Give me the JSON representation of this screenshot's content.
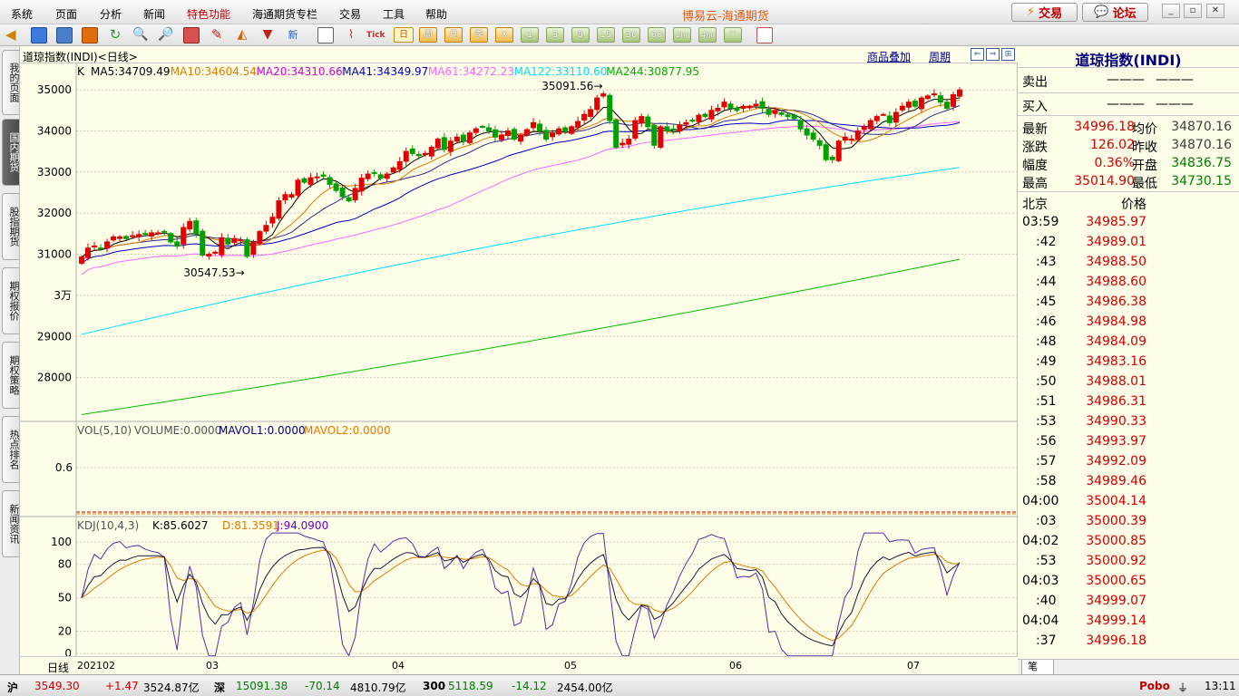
{
  "menu": {
    "items": [
      "系统",
      "页面",
      "分析",
      "新闻",
      "特色功能",
      "海通期货专栏",
      "交易",
      "工具",
      "帮助"
    ],
    "highlight_index": 4,
    "brand": "博易云-海通期货",
    "trade_btn": "交易",
    "forum_btn": "论坛"
  },
  "toolbar": {
    "periods": [
      "日",
      "周",
      "月",
      "季",
      "X",
      "1",
      "3",
      "5",
      "15",
      "30",
      "60",
      "2hr",
      "4hr",
      "Y"
    ],
    "selected_period": "日"
  },
  "left_tabs": [
    "我的页面",
    "国内期货",
    "股指期货",
    "期权报价",
    "期权策略",
    "热点排名",
    "新闻资讯"
  ],
  "left_tabs_active": 1,
  "chart": {
    "header_title": "道琼指数(INDI)<日线>",
    "link_overlay": "商品叠加",
    "link_period": "周期",
    "k_label": "K",
    "ma_labels": [
      {
        "text": "MA5:34709.49",
        "color": "#000000"
      },
      {
        "text": "MA10:34604.54",
        "color": "#e07b00"
      },
      {
        "text": "MA20:34310.66",
        "color": "#d400d4"
      },
      {
        "text": "MA41:34349.97",
        "color": "#0000c0"
      },
      {
        "text": "MA61:34272.23",
        "color": "#ff66ff"
      },
      {
        "text": "MA122:33110.60",
        "color": "#00e0ff"
      },
      {
        "text": "MA244:30877.95",
        "color": "#00b000"
      }
    ],
    "vol_label": "VOL(5,10)",
    "vol_value": "VOLUME:0.0000",
    "mavol1": "MAVOL1:0.0000",
    "mavol2": "MAVOL2:0.0000",
    "vol_tick": "0.6",
    "kdj_label": "KDJ(10,4,3)",
    "kdj_k": "K:85.6027",
    "kdj_d": "D:81.3591",
    "kdj_j": "J:94.0900",
    "kdj_ticks": [
      "100",
      "80",
      "50",
      "20",
      "0"
    ],
    "y_ticks": [
      "35000",
      "34000",
      "33000",
      "32000",
      "31000",
      "3万",
      "29000",
      "28000"
    ],
    "high_annot": "35091.56",
    "low_annot": "30547.53",
    "date_axis_label": "日线",
    "date_labels": [
      "202102",
      "03",
      "04",
      "05",
      "06",
      "07"
    ]
  },
  "chart_data": {
    "type": "candlestick",
    "ylim": [
      27000,
      35200
    ],
    "high": 35091.56,
    "low": 30547.53,
    "ma": {
      "MA5": 34709.49,
      "MA10": 34604.54,
      "MA20": 34310.66,
      "MA41": 34349.97,
      "MA61": 34272.23,
      "MA122": 33110.6,
      "MA244": 30877.95
    },
    "approx_closes": [
      30930,
      31150,
      31200,
      31150,
      31300,
      31420,
      31420,
      31380,
      31450,
      31480,
      31500,
      31520,
      31520,
      31550,
      31300,
      31200,
      31650,
      31800,
      31500,
      30980,
      31000,
      31050,
      31400,
      31250,
      31380,
      31350,
      30950,
      31300,
      31550,
      31700,
      31900,
      32300,
      32450,
      32450,
      32800,
      32750,
      32860,
      32880,
      32900,
      32700,
      32550,
      32400,
      32300,
      32600,
      32850,
      32950,
      32980,
      32850,
      32950,
      33100,
      33250,
      33500,
      33450,
      33400,
      33450,
      33600,
      33800,
      33550,
      33750,
      33850,
      33750,
      33950,
      34050,
      34100,
      34000,
      33850,
      33900,
      34000,
      33800,
      33900,
      34030,
      34200,
      34000,
      33800,
      33950,
      34050,
      34000,
      34100,
      34230,
      34400,
      34520,
      34800,
      34900,
      34250,
      33600,
      33700,
      33800,
      34250,
      34350,
      34100,
      33650,
      34100,
      34000,
      34030,
      34150,
      34200,
      34250,
      34380,
      34350,
      34500,
      34550,
      34700,
      34550,
      34500,
      34600,
      34600,
      34650,
      34550,
      34400,
      34500,
      34400,
      34350,
      34300,
      34050,
      33900,
      33800,
      33650,
      33300,
      33300,
      33750,
      33850,
      33800,
      34000,
      34100,
      34250,
      34350,
      34400,
      34200,
      34450,
      34600,
      34700,
      34600,
      34800,
      34850,
      34900,
      34700,
      34550,
      34880,
      34996.18
    ]
  },
  "quote": {
    "title": "道琼指数(INDI)",
    "sell_label": "卖出",
    "sell_value": "———",
    "sell_qty": "———",
    "buy_label": "买入",
    "buy_value": "———",
    "buy_qty": "———",
    "rows": [
      {
        "l1": "最新",
        "v1": "34996.18",
        "l2": "均价",
        "v2": "34870.16"
      },
      {
        "l1": "涨跌",
        "v1": "126.02",
        "l2": "昨收",
        "v2": "34870.16"
      },
      {
        "l1": "幅度",
        "v1": "0.36%",
        "l2": "开盘",
        "v2": "34836.75"
      },
      {
        "l1": "最高",
        "v1": "35014.90",
        "l2": "最低",
        "v2": "34730.15"
      }
    ],
    "ticks_header_left": "北京",
    "ticks_header_right": "价格",
    "ticks": [
      {
        "t": "03:59",
        "p": "34985.97"
      },
      {
        "t": ":42",
        "p": "34989.01"
      },
      {
        "t": ":43",
        "p": "34988.50"
      },
      {
        "t": ":44",
        "p": "34988.60"
      },
      {
        "t": ":45",
        "p": "34986.38"
      },
      {
        "t": ":46",
        "p": "34984.98"
      },
      {
        "t": ":48",
        "p": "34984.09"
      },
      {
        "t": ":49",
        "p": "34983.16"
      },
      {
        "t": ":50",
        "p": "34988.01"
      },
      {
        "t": ":51",
        "p": "34986.31"
      },
      {
        "t": ":53",
        "p": "34990.33"
      },
      {
        "t": ":56",
        "p": "34993.97"
      },
      {
        "t": ":57",
        "p": "34992.09"
      },
      {
        "t": ":58",
        "p": "34989.46"
      },
      {
        "t": "04:00",
        "p": "35004.14"
      },
      {
        "t": ":03",
        "p": "35000.39"
      },
      {
        "t": "04:02",
        "p": "35000.85"
      },
      {
        "t": ":53",
        "p": "35000.92"
      },
      {
        "t": "04:03",
        "p": "35000.65"
      },
      {
        "t": ":40",
        "p": "34999.07"
      },
      {
        "t": "04:04",
        "p": "34999.14"
      },
      {
        "t": ":37",
        "p": "34996.18"
      }
    ],
    "footer_tab": "笔"
  },
  "status": {
    "sh_label": "沪",
    "sh_val": "3549.30",
    "sh_chg": "+1.47",
    "sh_amt": "3524.87亿",
    "sz_label": "深",
    "sz_val": "15091.38",
    "sz_chg": "-70.14",
    "sz_amt": "4810.79亿",
    "c300_label": "300",
    "c300_val": "5118.59",
    "c300_chg": "-14.12",
    "c300_amt": "2454.00亿",
    "brand": "Pobo",
    "time": "13:11"
  }
}
